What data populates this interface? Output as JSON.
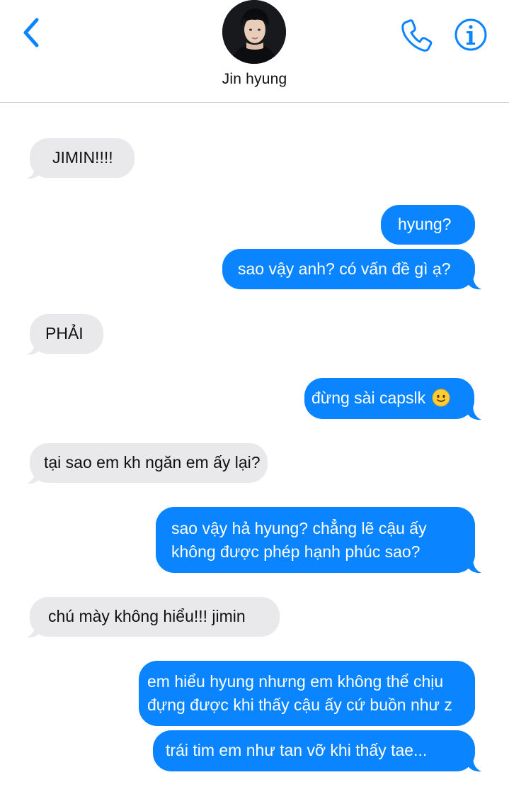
{
  "header": {
    "contact_name": "Jin hyung",
    "back_icon": "chevron-left-icon",
    "call_icon": "phone-icon",
    "info_icon": "info-icon",
    "accent_color": "#0a84ff"
  },
  "messages": [
    {
      "direction": "incoming",
      "lines": [
        "JIMIN!!!!"
      ]
    },
    {
      "direction": "outgoing",
      "lines": [
        "hyung?"
      ]
    },
    {
      "direction": "outgoing",
      "lines": [
        "sao vậy anh? có vấn đề gì ạ?"
      ]
    },
    {
      "direction": "incoming",
      "lines": [
        "PHẢI"
      ]
    },
    {
      "direction": "outgoing",
      "lines": [
        "đừng sài capslk"
      ],
      "emoji": "🙂"
    },
    {
      "direction": "incoming",
      "lines": [
        "tại sao em kh ngăn em ấy lại?"
      ]
    },
    {
      "direction": "outgoing",
      "lines": [
        "sao vậy hả hyung? chẳng lẽ cậu ấy",
        "không được phép hạnh phúc sao?"
      ]
    },
    {
      "direction": "incoming",
      "lines": [
        "chú mày không hiểu!!! jimin"
      ]
    },
    {
      "direction": "outgoing",
      "lines": [
        "em hiểu hyung nhưng em không thể chịu",
        "đựng được khi thấy cậu ấy cứ buồn như z"
      ]
    },
    {
      "direction": "outgoing",
      "lines": [
        "trái tim em như tan vỡ khi thấy tae..."
      ]
    }
  ],
  "colors": {
    "incoming_bubble": "#e9e9eb",
    "outgoing_bubble": "#0a84ff"
  }
}
